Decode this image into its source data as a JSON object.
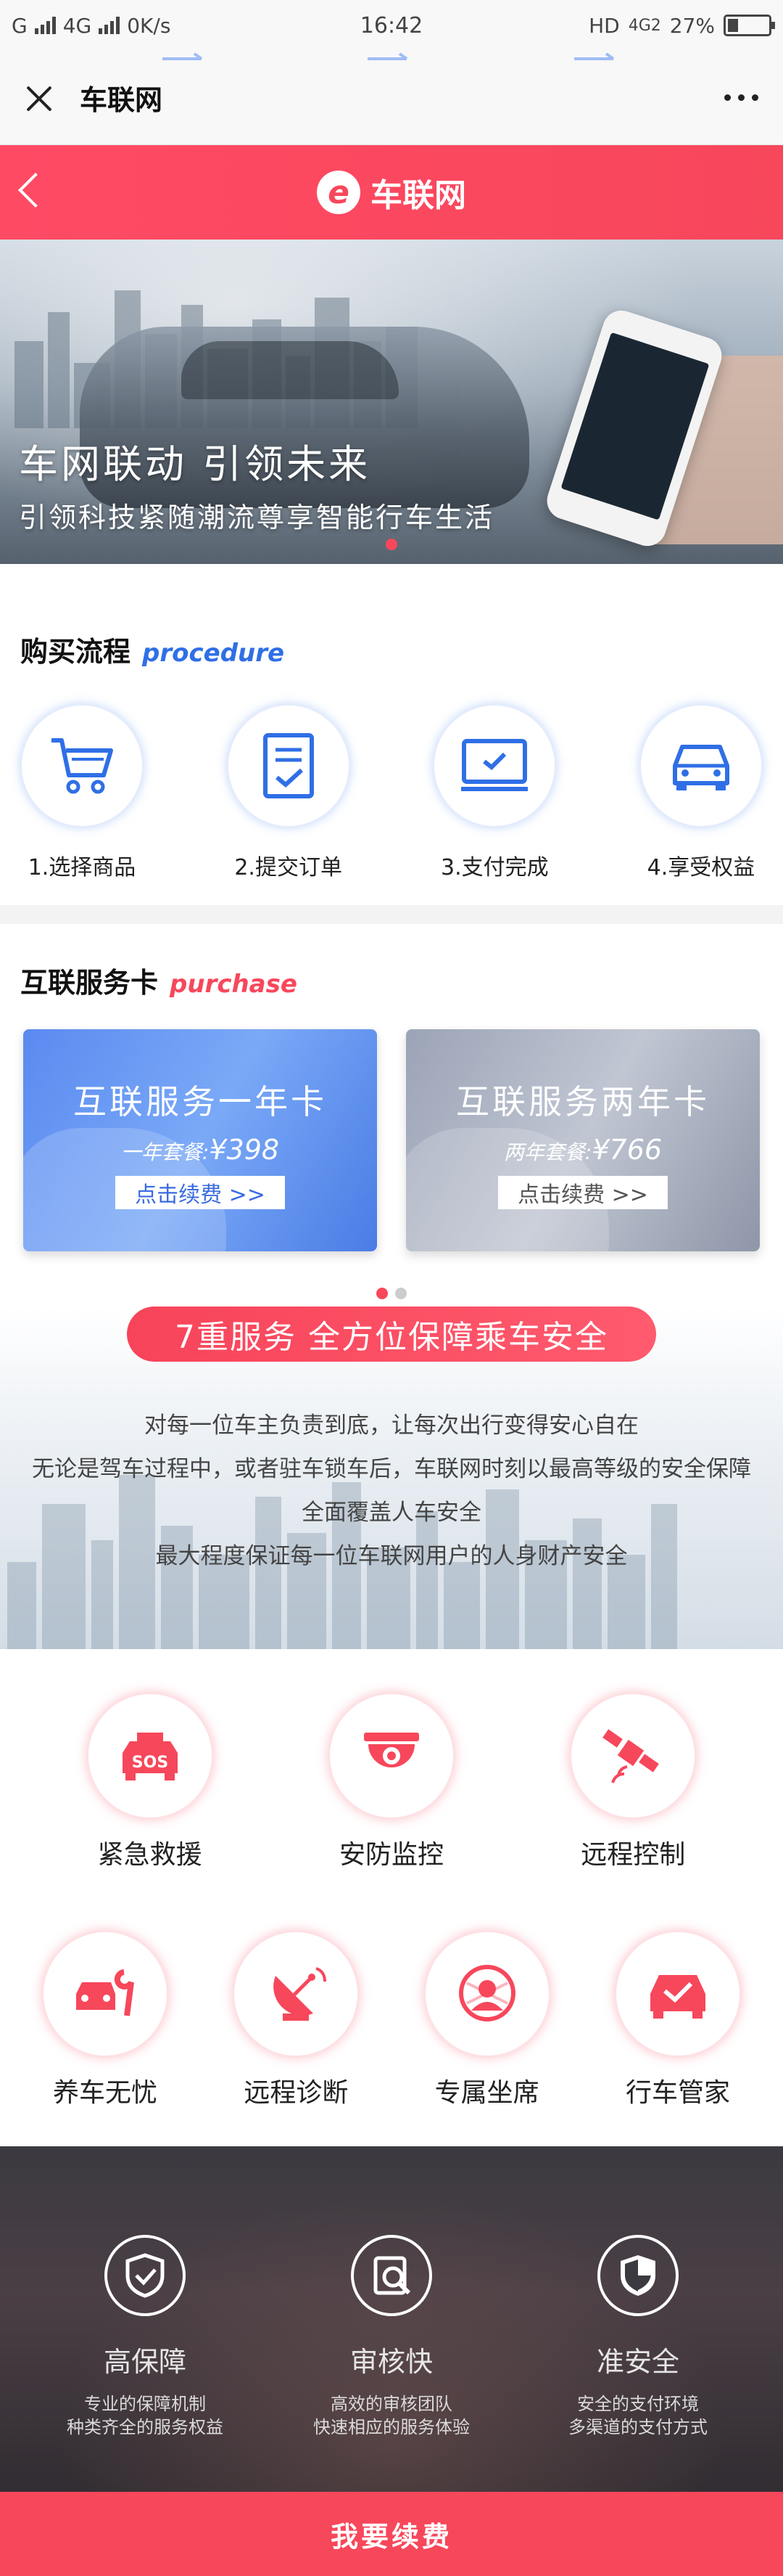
{
  "status_bar": {
    "carrier_left": "G",
    "network": "4G",
    "speed": "0K/s",
    "time": "16:42",
    "network_right": "HD",
    "network_right2": "4G2",
    "battery": "27%"
  },
  "browser": {
    "title": "车联网"
  },
  "app_header": {
    "logo_letter": "e",
    "title": "车联网"
  },
  "banner": {
    "title": "车网联动  引领未来",
    "subtitle": "引领科技紧随潮流尊享智能行车生活"
  },
  "procedure": {
    "title_cn": "购买流程",
    "title_en": "procedure",
    "steps": [
      {
        "label": "1.选择商品",
        "icon": "cart-icon"
      },
      {
        "label": "2.提交订单",
        "icon": "order-icon"
      },
      {
        "label": "3.支付完成",
        "icon": "payment-icon"
      },
      {
        "label": "4.享受权益",
        "icon": "car-icon"
      }
    ]
  },
  "cards": {
    "title_cn": "互联服务卡",
    "title_en": "purchase",
    "items": [
      {
        "title": "互联服务一年卡",
        "price_prefix": "一年套餐:",
        "price": "¥398",
        "button": "点击续费 >>"
      },
      {
        "title": "互联服务两年卡",
        "price_prefix": "两年套餐:",
        "price": "¥766",
        "button": "点击续费 >>"
      }
    ]
  },
  "safety": {
    "pill": "7重服务   全方位保障乘车安全",
    "lines": [
      "对每一位车主负责到底，让每次出行变得安心自在",
      "无论是驾车过程中，或者驻车锁车后，车联网时刻以最高等级的安全保障全面覆盖人车安全",
      "最大程度保证每一位车联网用户的人身财产安全"
    ]
  },
  "services": {
    "row1": [
      {
        "label": "紧急救援",
        "icon": "sos-car-icon"
      },
      {
        "label": "安防监控",
        "icon": "camera-icon"
      },
      {
        "label": "远程控制",
        "icon": "satellite-icon"
      }
    ],
    "row2": [
      {
        "label": "养车无忧",
        "icon": "wrench-car-icon"
      },
      {
        "label": "远程诊断",
        "icon": "dish-icon"
      },
      {
        "label": "专属坐席",
        "icon": "agent-icon"
      },
      {
        "label": "行车管家",
        "icon": "car-check-icon"
      }
    ]
  },
  "guarantees": [
    {
      "title": "高保障",
      "desc1": "专业的保障机制",
      "desc2": "种类齐全的服务权益",
      "icon": "shield-check-icon"
    },
    {
      "title": "审核快",
      "desc1": "高效的审核团队",
      "desc2": "快速相应的服务体验",
      "icon": "magnifier-doc-icon"
    },
    {
      "title": "准安全",
      "desc1": "安全的支付环境",
      "desc2": "多渠道的支付方式",
      "icon": "shield-half-icon"
    }
  ],
  "renew_button": "我要续费",
  "colors": {
    "accent": "#f7475b",
    "blue": "#3a6be0"
  }
}
